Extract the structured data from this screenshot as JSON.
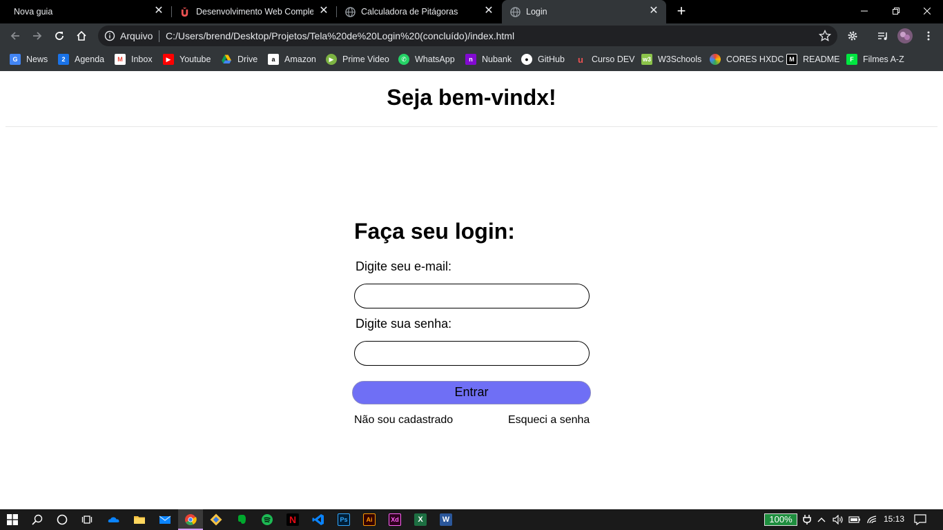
{
  "browser": {
    "tabs": [
      {
        "title": "Nova guia",
        "active": false
      },
      {
        "title": "Desenvolvimento Web Completo",
        "active": false
      },
      {
        "title": "Calculadora de Pitágoras",
        "active": false
      },
      {
        "title": "Login",
        "active": true
      }
    ],
    "address": {
      "scheme_label": "Arquivo",
      "url": "C:/Users/brend/Desktop/Projetos/Tela%20de%20Login%20(concluído)/index.html"
    },
    "bookmarks": [
      {
        "label": "News",
        "icon": "google-news-icon",
        "color": "#4285f4"
      },
      {
        "label": "Agenda",
        "icon": "google-calendar-icon",
        "color": "#1a73e8"
      },
      {
        "label": "Inbox",
        "icon": "gmail-icon",
        "color": "#ea4335"
      },
      {
        "label": "Youtube",
        "icon": "youtube-icon",
        "color": "#ff0000"
      },
      {
        "label": "Drive",
        "icon": "google-drive-icon",
        "color": "#0f9d58"
      },
      {
        "label": "Amazon",
        "icon": "amazon-icon",
        "color": "#ffffff"
      },
      {
        "label": "Prime Video",
        "icon": "prime-video-icon",
        "color": "#7cb342"
      },
      {
        "label": "WhatsApp",
        "icon": "whatsapp-icon",
        "color": "#25d366"
      },
      {
        "label": "Nubank",
        "icon": "nubank-icon",
        "color": "#820ad1"
      },
      {
        "label": "GitHub",
        "icon": "github-icon",
        "color": "#ffffff"
      },
      {
        "label": "Curso DEV",
        "icon": "udemy-icon",
        "color": "#ec5252"
      },
      {
        "label": "W3Schools",
        "icon": "w3schools-icon",
        "color": "#8bc34a"
      },
      {
        "label": "CORES HXDC",
        "icon": "color-wheel-icon",
        "color": "#ffffff"
      },
      {
        "label": "README",
        "icon": "medium-icon",
        "color": "#000000"
      },
      {
        "label": "Filmes A-Z",
        "icon": "filmes-icon",
        "color": "#00e640"
      }
    ]
  },
  "page": {
    "title": "Seja bem-vindx!",
    "login": {
      "heading": "Faça seu login:",
      "email_label": "Digite seu e-mail:",
      "email_value": "",
      "password_label": "Digite sua senha:",
      "password_value": "",
      "submit_label": "Entrar",
      "submit_color": "#6f6ff5",
      "register_link": "Não sou cadastrado",
      "forgot_link": "Esqueci a senha"
    }
  },
  "taskbar": {
    "apps": [
      "windows-start-icon",
      "search-icon",
      "cortana-icon",
      "task-view-icon",
      "onedrive-icon",
      "file-explorer-icon",
      "mail-icon",
      "chrome-icon",
      "git-icon",
      "evernote-icon",
      "spotify-icon",
      "netflix-icon",
      "vscode-icon",
      "photoshop-icon",
      "illustrator-icon",
      "adobe-xd-icon",
      "excel-icon",
      "word-icon"
    ],
    "app_letters": {
      "photoshop": "Ps",
      "illustrator": "Ai",
      "xd": "Xd",
      "excel": "X",
      "word": "W",
      "netflix": "N"
    },
    "battery_percent": "100%",
    "clock": "15:13"
  }
}
